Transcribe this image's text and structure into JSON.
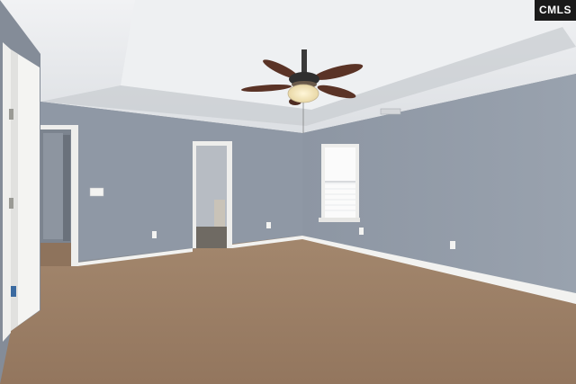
{
  "watermark": {
    "text": "CMLS"
  },
  "colors": {
    "wall": "#8f98a5",
    "wall_shade": "#7f8894",
    "ceiling": "#e9ebee",
    "carpet": "#9c8067",
    "trim": "#f2f2f0",
    "fan_blade": "#5a3326"
  }
}
